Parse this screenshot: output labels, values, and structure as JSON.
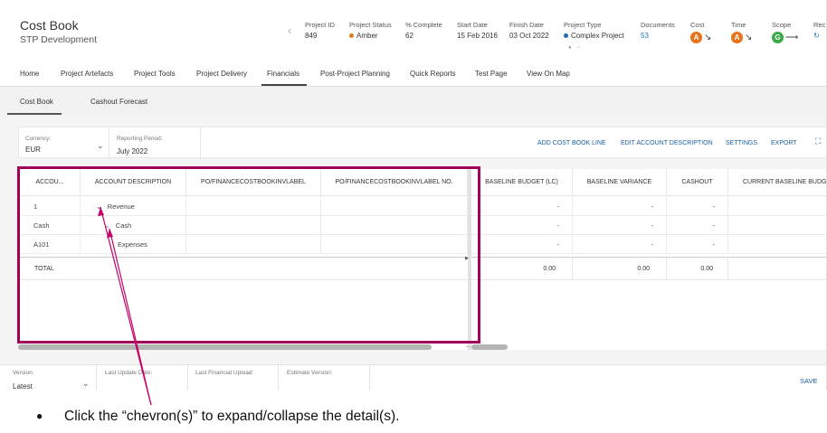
{
  "app": {
    "title": "Cost Book",
    "subtitle": "STP Development"
  },
  "header": {
    "project_id_label": "Project ID",
    "project_id": "849",
    "status_label": "Project Status",
    "status": "Amber",
    "status_color": "#e07a1f",
    "complete_label": "% Complete",
    "complete": "62",
    "start_label": "Start Date",
    "start": "15 Feb 2016",
    "finish_label": "Finish Date",
    "finish": "03 Oct 2022",
    "type_label": "Project Type",
    "type": "Complex Project",
    "type_color": "#1a6fb5",
    "documents_label": "Documents",
    "documents": "53",
    "cost_label": "Cost",
    "cost_badge": "A",
    "cost_color": "#e8731a",
    "time_label": "Time",
    "time_badge": "A",
    "time_color": "#e8731a",
    "scope_label": "Scope",
    "scope_badge": "G",
    "scope_color": "#3aaa48",
    "more_label": "Rec"
  },
  "nav": {
    "items": [
      "Home",
      "Project Artefacts",
      "Project Tools",
      "Project Delivery",
      "Financials",
      "Post-Project Planning",
      "Quick Reports",
      "Test Page",
      "View On Map"
    ],
    "active": "Financials"
  },
  "subtabs": [
    "Cost Book",
    "Cashout Forecast"
  ],
  "toolbar": {
    "currency_label": "Currency:",
    "currency": "EUR",
    "period_label": "Reporting Period:",
    "period": "July 2022",
    "actions": [
      "ADD COST BOOK LINE",
      "EDIT ACCOUNT DESCRIPTION",
      "SETTINGS",
      "EXPORT"
    ]
  },
  "grid": {
    "columns": [
      "ACCOU...",
      "ACCOUNT DESCRIPTION",
      "PO/FINANCECOSTBOOKINVLABEL",
      "PO/FINANCECOSTBOOKINVLABEL NO.",
      "BASELINE BUDGET (LC)",
      "BASELINE VARIANCE",
      "CASHOUT",
      "CURRENT BASELINE BUDGET"
    ],
    "rows": [
      {
        "account": "1",
        "description": "Revenue",
        "budget": "-",
        "variance": "-",
        "cashout": "-"
      },
      {
        "account": "Cash",
        "description": "Cash",
        "budget": "-",
        "variance": "-",
        "cashout": "-"
      },
      {
        "account": "A101",
        "description": "Expenses",
        "budget": "-",
        "variance": "-",
        "cashout": "-"
      }
    ],
    "total": {
      "label": "TOTAL",
      "budget": "0.00",
      "variance": "0.00",
      "cashout": "0.00"
    }
  },
  "footer": {
    "version_label": "Version:",
    "version": "Latest",
    "last_update_label": "Last Update Date:",
    "last_upload_label": "Last Financial Upload:",
    "estimate_label": "Estimate Version:",
    "save": "SAVE"
  },
  "annotation": {
    "instruction": "Click the “chevron(s)” to expand/collapse the detail(s).",
    "highlight_color": "#a0005a"
  }
}
